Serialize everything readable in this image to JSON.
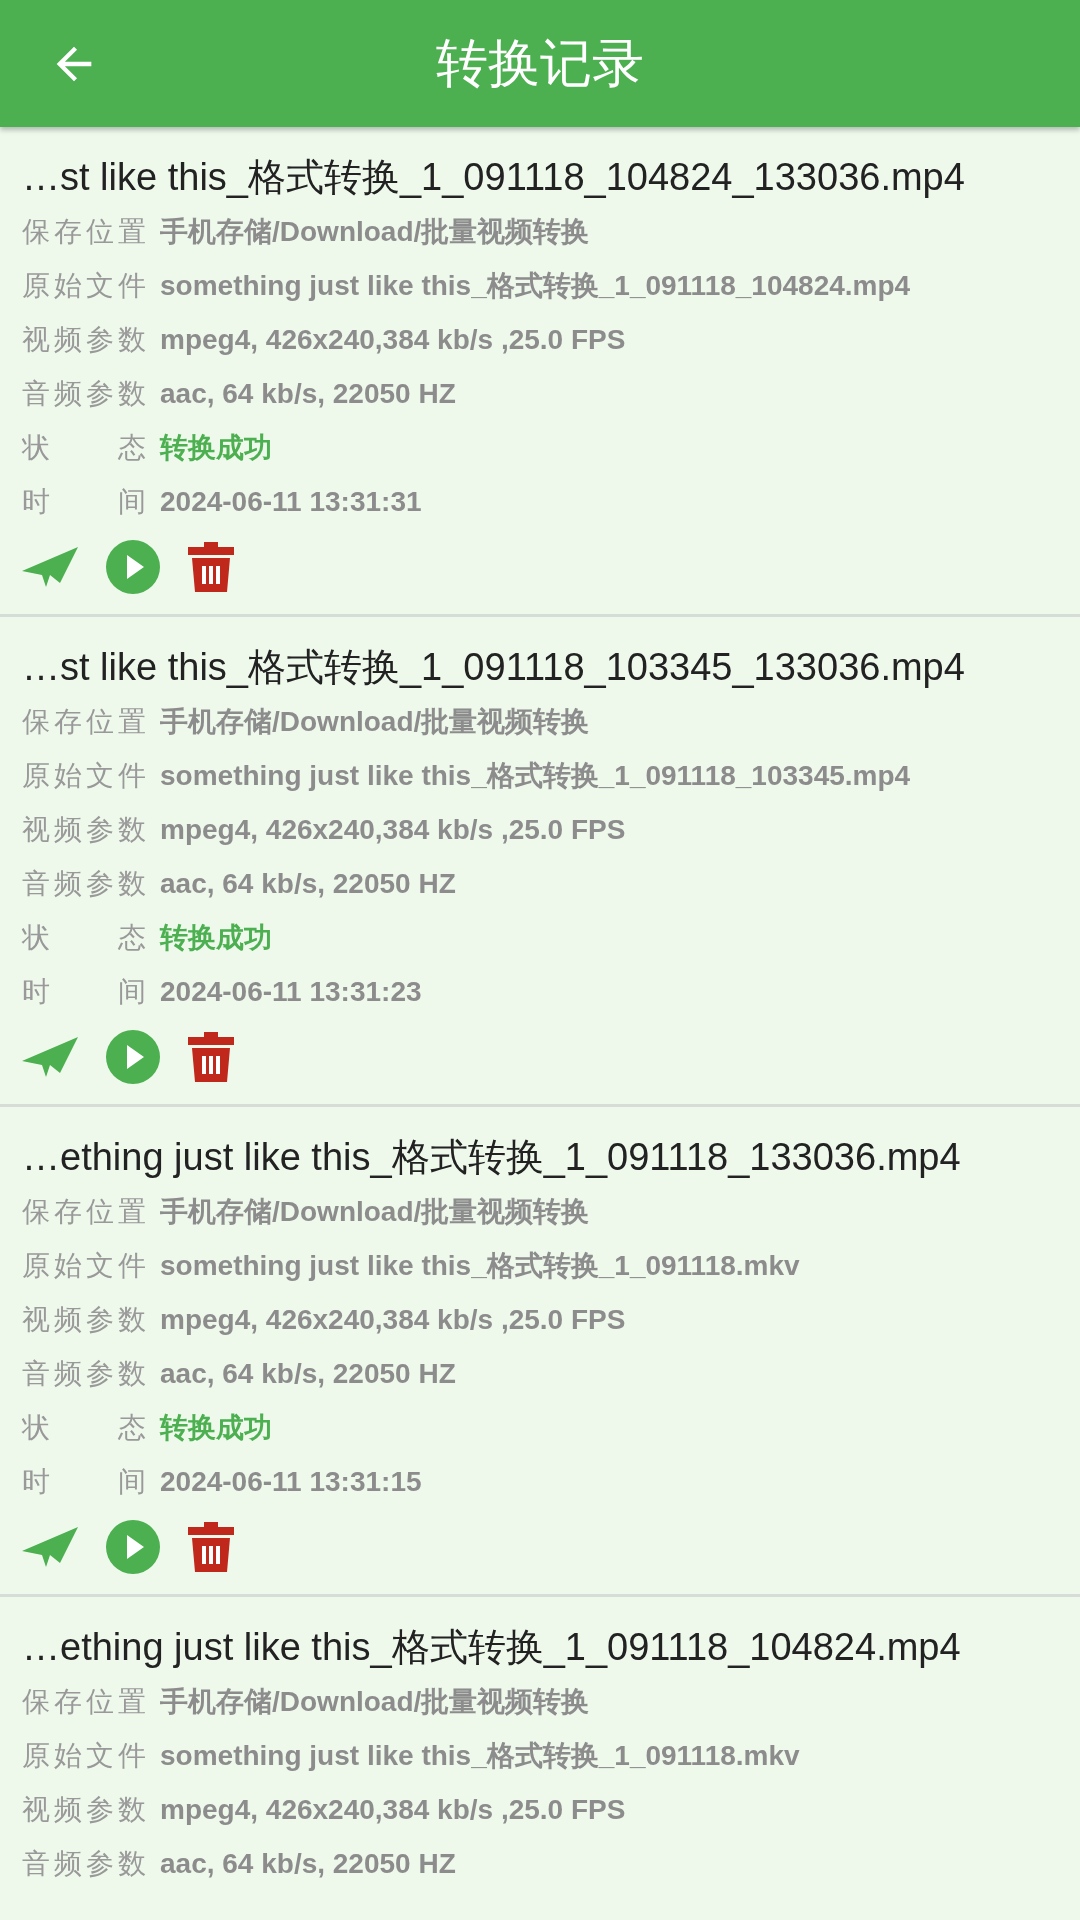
{
  "header": {
    "title": "转换记录"
  },
  "records": [
    {
      "filename": "…st like this_格式转换_1_091118_104824_133036.mp4",
      "fields": [
        {
          "kind": "info",
          "label": "保存位置",
          "value": "手机存储/Download/批量视频转换"
        },
        {
          "kind": "info",
          "label": "原始文件",
          "value": "something just like this_格式转换_1_091118_104824.mp4"
        },
        {
          "kind": "info",
          "label": "视频参数",
          "value": "mpeg4, 426x240,384 kb/s ,25.0 FPS"
        },
        {
          "kind": "info",
          "label": "音频参数",
          "value": "aac, 64 kb/s, 22050 HZ"
        },
        {
          "kind": "status",
          "label": "状 态",
          "value": "转换成功"
        },
        {
          "kind": "info",
          "label": "时 间",
          "value": "2024-06-11 13:31:31"
        }
      ],
      "actions": true
    },
    {
      "filename": "…st like this_格式转换_1_091118_103345_133036.mp4",
      "fields": [
        {
          "kind": "info",
          "label": "保存位置",
          "value": "手机存储/Download/批量视频转换"
        },
        {
          "kind": "info",
          "label": "原始文件",
          "value": "something just like this_格式转换_1_091118_103345.mp4"
        },
        {
          "kind": "info",
          "label": "视频参数",
          "value": "mpeg4, 426x240,384 kb/s ,25.0 FPS"
        },
        {
          "kind": "info",
          "label": "音频参数",
          "value": "aac, 64 kb/s, 22050 HZ"
        },
        {
          "kind": "status",
          "label": "状 态",
          "value": "转换成功"
        },
        {
          "kind": "info",
          "label": "时 间",
          "value": "2024-06-11 13:31:23"
        }
      ],
      "actions": true
    },
    {
      "filename": "…ething just like this_格式转换_1_091118_133036.mp4",
      "fields": [
        {
          "kind": "info",
          "label": "保存位置",
          "value": "手机存储/Download/批量视频转换"
        },
        {
          "kind": "info",
          "label": "原始文件",
          "value": "something just like this_格式转换_1_091118.mkv"
        },
        {
          "kind": "info",
          "label": "视频参数",
          "value": "mpeg4, 426x240,384 kb/s ,25.0 FPS"
        },
        {
          "kind": "info",
          "label": "音频参数",
          "value": "aac, 64 kb/s, 22050 HZ"
        },
        {
          "kind": "status",
          "label": "状 态",
          "value": "转换成功"
        },
        {
          "kind": "info",
          "label": "时 间",
          "value": "2024-06-11 13:31:15"
        }
      ],
      "actions": true
    },
    {
      "filename": "…ething just like this_格式转换_1_091118_104824.mp4",
      "fields": [
        {
          "kind": "info",
          "label": "保存位置",
          "value": "手机存储/Download/批量视频转换"
        },
        {
          "kind": "info",
          "label": "原始文件",
          "value": "something just like this_格式转换_1_091118.mkv"
        },
        {
          "kind": "info",
          "label": "视频参数",
          "value": "mpeg4, 426x240,384 kb/s ,25.0 FPS"
        },
        {
          "kind": "info",
          "label": "音频参数",
          "value": "aac, 64 kb/s, 22050 HZ"
        }
      ],
      "actions": false
    }
  ]
}
